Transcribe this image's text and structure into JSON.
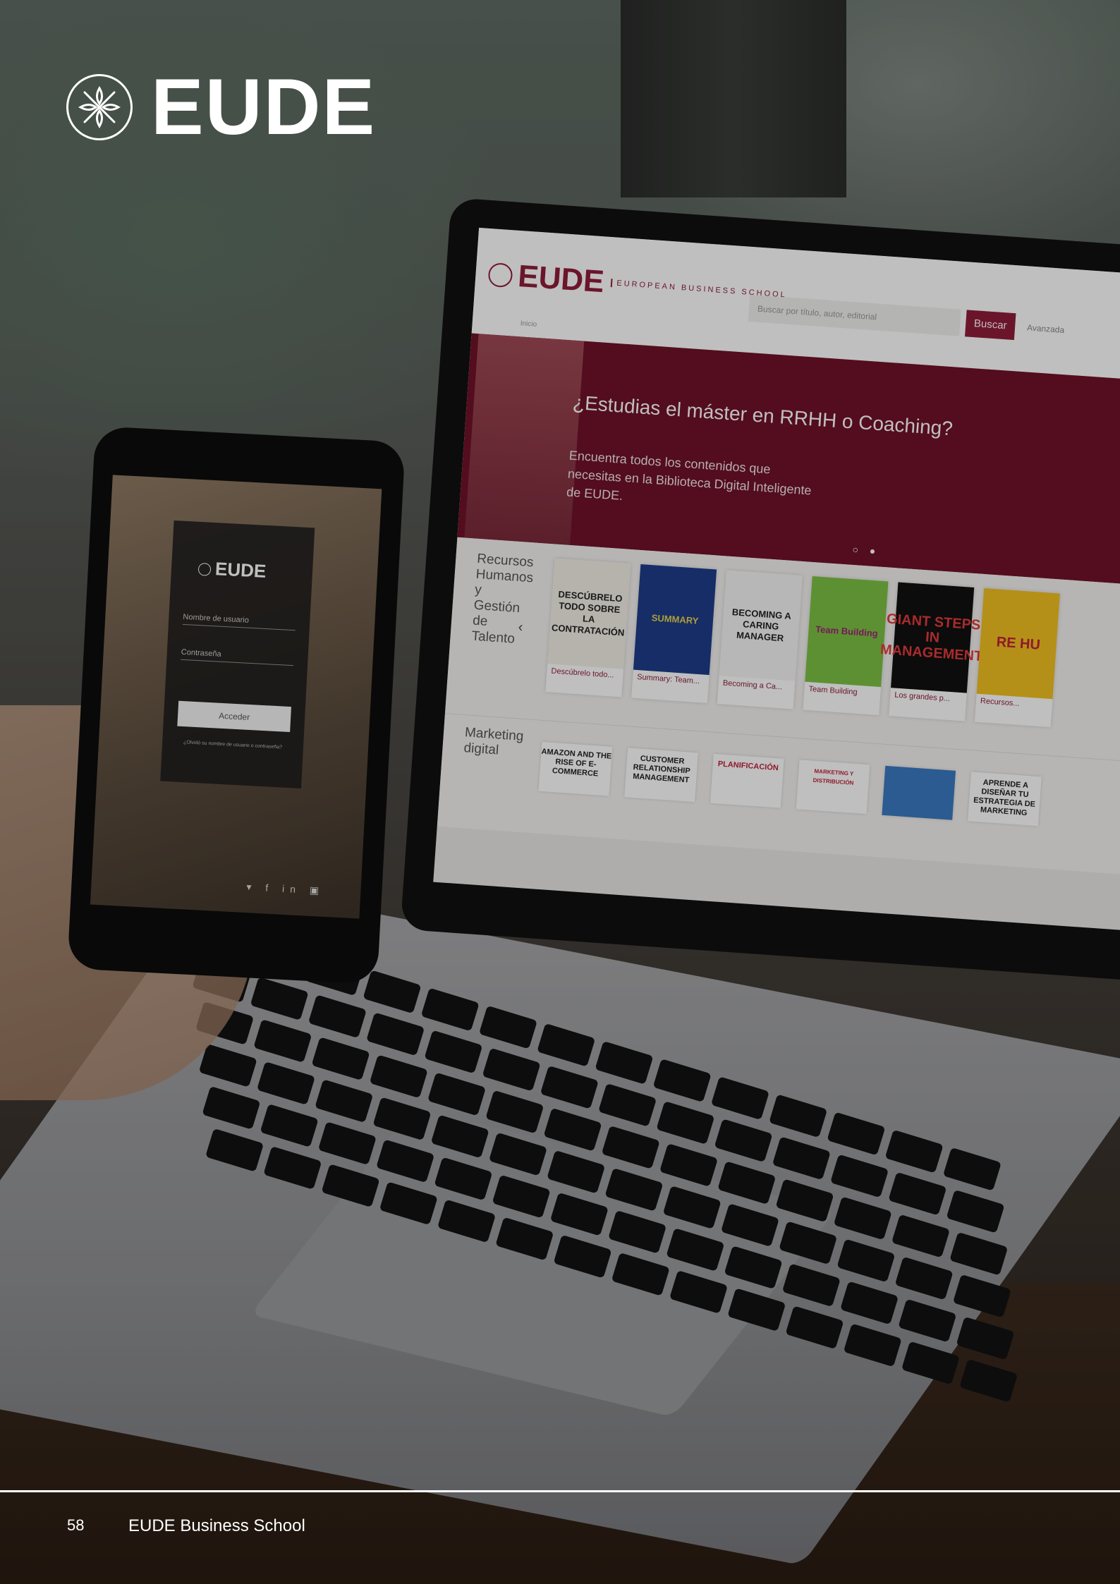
{
  "brand": {
    "name": "EUDE",
    "emblem_icon": "ornamental-flower-icon",
    "color": "#ffffff"
  },
  "laptop": {
    "site": {
      "logo_name": "EUDE",
      "logo_sub": "EUROPEAN BUSINESS SCHOOL",
      "search_placeholder": "Buscar por título, autor, editorial",
      "search_button": "Buscar",
      "advanced_link": "Avanzada",
      "breadcrumb": "Inicio",
      "accent": "#8f1d3a"
    },
    "hero": {
      "title": "¿Estudias el máster en RRHH o Coaching?",
      "subtitle": "Encuentra todos los contenidos que necesitas en la Biblioteca Digital Inteligente de EUDE.",
      "dots": "○ ●"
    },
    "shelf1": {
      "label": "Recursos Humanos y Gestión de Talento",
      "arrow": "‹",
      "books": [
        {
          "cover": "DESCÚBRELO TODO SOBRE LA CONTRATACIÓN",
          "caption": "Descúbrelo todo..."
        },
        {
          "cover": "SUMMARY",
          "caption": "Summary: Team..."
        },
        {
          "cover": "BECOMING A CARING MANAGER",
          "caption": "Becoming a Ca..."
        },
        {
          "cover": "Team Building",
          "caption": "Team Building"
        },
        {
          "cover": "GIANT STEPS IN MANAGEMENT",
          "caption": "Los grandes p..."
        },
        {
          "cover": "RE HU",
          "caption": "Recursos..."
        }
      ]
    },
    "shelf2": {
      "label": "Marketing digital",
      "books": [
        "AMAZON AND THE RISE OF E-COMMERCE",
        "CUSTOMER RELATIONSHIP MANAGEMENT",
        "PLANIFICACIÓN",
        "MARKETING Y DISTRIBUCIÓN",
        "",
        "APRENDE A DISEÑAR TU ESTRATEGIA DE MARKETING"
      ]
    }
  },
  "phone": {
    "login": {
      "logo": "EUDE",
      "username_placeholder": "Nombre de usuario",
      "password_placeholder": "Contraseña",
      "button": "Acceder",
      "forgot": "¿Olvidó su nombre de usuario o contraseña?"
    },
    "social": "▾ f in ▣"
  },
  "footer": {
    "page_number": "58",
    "title": "EUDE Business School"
  }
}
